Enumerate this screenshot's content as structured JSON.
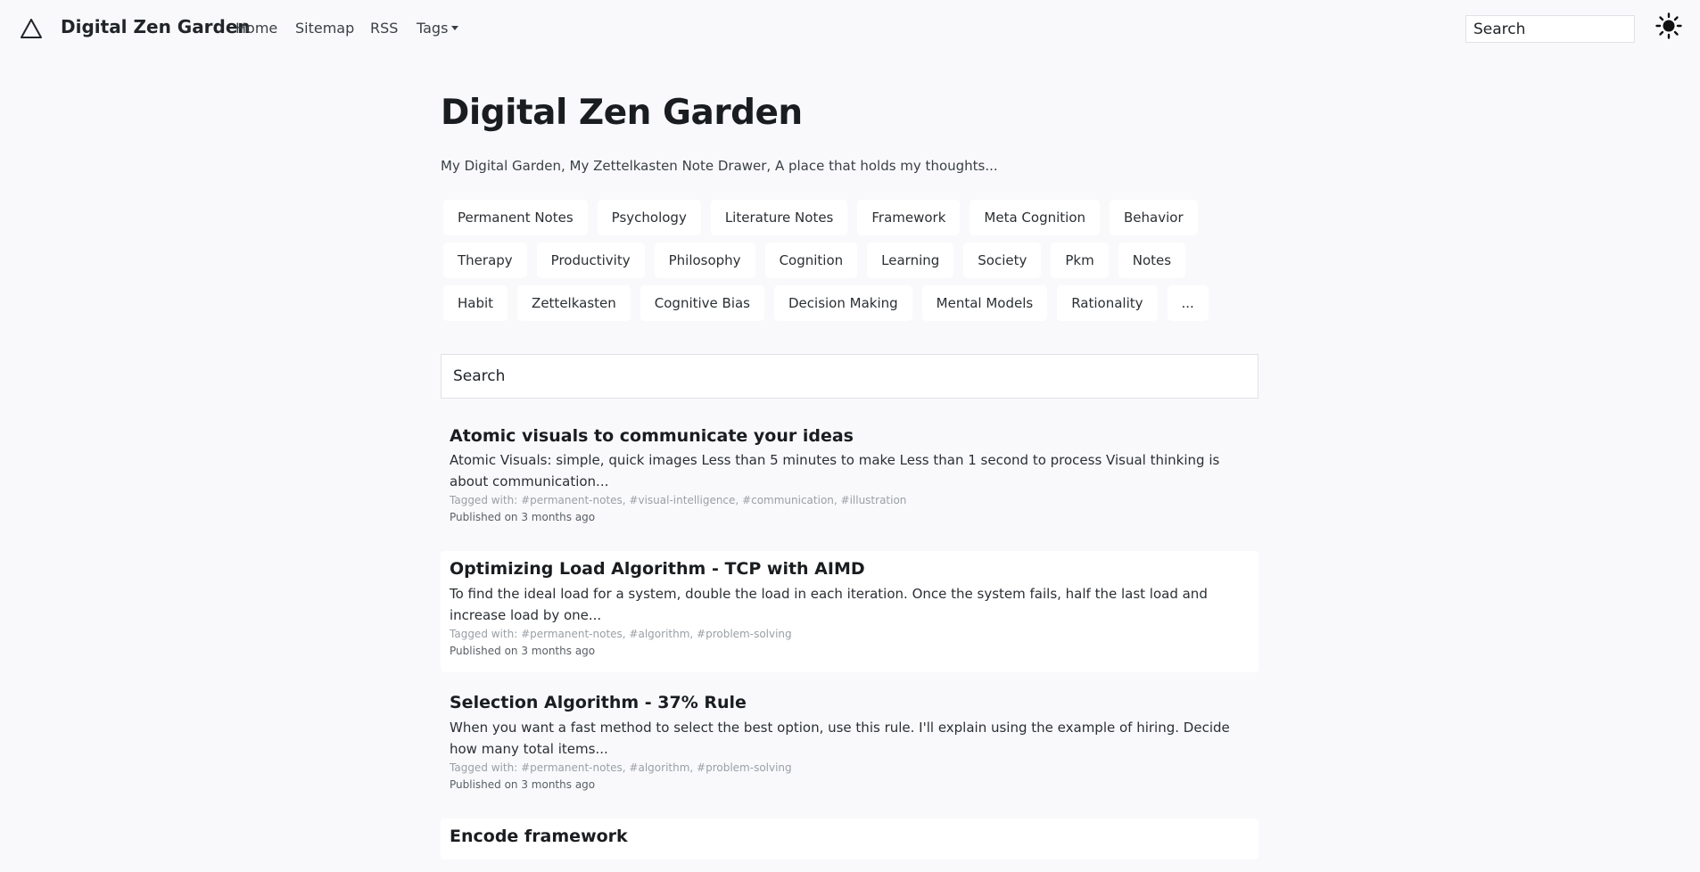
{
  "navbar": {
    "logo_icon": "triangle-logo-icon",
    "brand": "Digital Zen Garden",
    "links": [
      "Home",
      "Sitemap",
      "RSS"
    ],
    "tags_menu": "Tags",
    "search_placeholder": "Search",
    "theme_icon": "sun-icon"
  },
  "header": {
    "title": "Digital Zen Garden",
    "description": "My Digital Garden, My Zettelkasten Note Drawer, A place that holds my thoughts..."
  },
  "tags": [
    "Permanent Notes",
    "Psychology",
    "Literature Notes",
    "Framework",
    "Meta Cognition",
    "Behavior",
    "Therapy",
    "Productivity",
    "Philosophy",
    "Cognition",
    "Learning",
    "Society",
    "Pkm",
    "Notes",
    "Habit",
    "Zettelkasten",
    "Cognitive Bias",
    "Decision Making",
    "Mental Models",
    "Rationality",
    "..."
  ],
  "search": {
    "placeholder": "Search"
  },
  "posts": [
    {
      "title": "Atomic visuals to communicate your ideas",
      "excerpt": "Atomic Visuals: simple, quick images Less than 5 minutes to make Less than 1 second to process Visual thinking is about communication...",
      "tags": "Tagged with: #permanent-notes, #visual-intelligence, #communication, #illustration",
      "date": "Published on 3 months ago"
    },
    {
      "title": "Optimizing Load Algorithm - TCP with AIMD",
      "excerpt": "To find the ideal load for a system, double the load in each iteration. Once the system fails, half the last load and increase load by one...",
      "tags": "Tagged with: #permanent-notes, #algorithm, #problem-solving",
      "date": "Published on 3 months ago"
    },
    {
      "title": "Selection Algorithm - 37% Rule",
      "excerpt": "When you want a fast method to select the best option, use this rule. I'll explain using the example of hiring. Decide how many total items...",
      "tags": "Tagged with: #permanent-notes, #algorithm, #problem-solving",
      "date": "Published on 3 months ago"
    },
    {
      "title": "Encode framework",
      "excerpt": "",
      "tags": "",
      "date": ""
    }
  ]
}
